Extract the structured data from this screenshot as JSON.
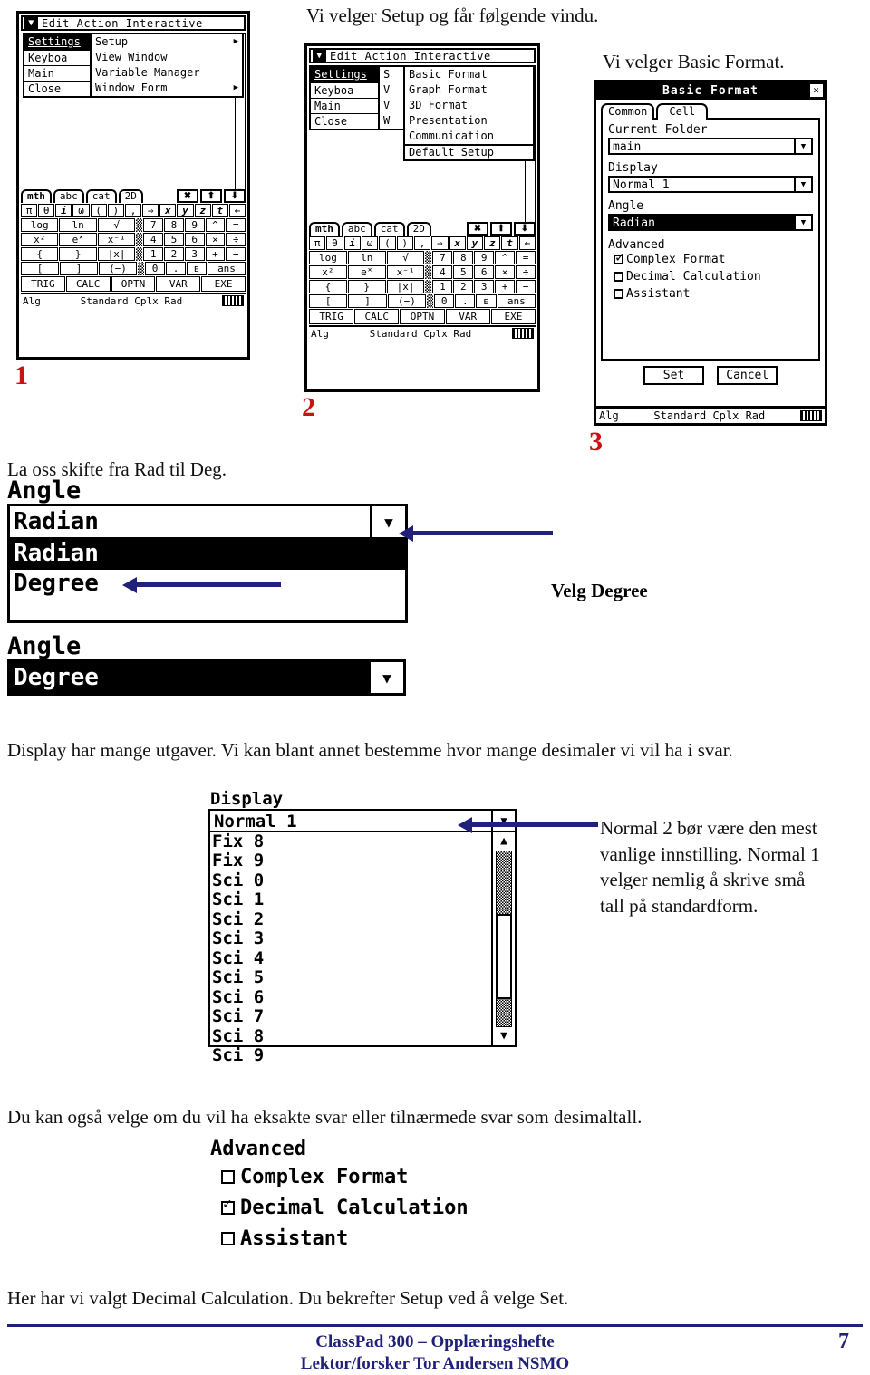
{
  "document": {
    "intro_text": "Vi velger Setup og får følgende vindu.",
    "basic_format_text": "Vi velger Basic Format.",
    "rad_to_deg_text": "La oss skifte fra Rad til Deg.",
    "velg_degree_text": "Velg Degree",
    "display_text": "Display har mange utgaver. Vi kan blant annet bestemme hvor mange desimaler vi vil ha i svar.",
    "normal_note": "Normal 2 bør være den mest vanlige innstilling. Normal 1 velger nemlig å skrive små tall på standardform.",
    "eksakt_text": "Du kan også velge om du vil ha eksakte svar eller tilnærmede svar som desimaltall.",
    "decimal_text": "Her har vi valgt Decimal Calculation. Du bekrefter Setup ved å velge Set."
  },
  "steps": {
    "one": "1",
    "two": "2",
    "three": "3"
  },
  "colors": {
    "step_red": "#cc1111",
    "arrow_blue": "#21217a"
  },
  "calculator": {
    "title_bar": "Edit Action Interactive",
    "logo_glyph": "▼",
    "settings_menu": [
      {
        "label": "Settings",
        "selected": true
      },
      {
        "label": "Keyboard",
        "selected": false
      },
      {
        "label": "Main",
        "selected": false
      },
      {
        "label": "Close",
        "selected": false
      }
    ],
    "settings_menu_clipped": [
      "Settings",
      "Keyboa",
      "Main",
      "Close"
    ],
    "setup_submenu": [
      {
        "label": "Setup",
        "arrow": "▶"
      },
      {
        "label": "View Window",
        "arrow": ""
      },
      {
        "label": "Variable Manager",
        "arrow": ""
      },
      {
        "label": "Window Form",
        "arrow": "▶"
      }
    ],
    "setup_submenu_clipped": [
      "S",
      "V",
      "V",
      "W"
    ],
    "setup_sub2": [
      {
        "label": "Basic Format"
      },
      {
        "label": "Graph Format"
      },
      {
        "label": "3D Format"
      },
      {
        "label": "Presentation"
      },
      {
        "label": "Communication"
      },
      {
        "label": "Default Setup"
      }
    ],
    "keyboard": {
      "tabs": [
        "mth",
        "abc",
        "cat",
        "2D"
      ],
      "tab_icons": [
        "✖",
        "⬆",
        "⬇"
      ],
      "row_symbols": [
        "π",
        "θ",
        "i",
        "ω",
        "(",
        ")",
        ",",
        "⇒",
        "x",
        "y",
        "z",
        "t",
        "←"
      ],
      "rows": [
        {
          "left": [
            "log",
            "ln",
            "√"
          ],
          "right": [
            "7",
            "8",
            "9"
          ],
          "ops": [
            "^",
            "="
          ]
        },
        {
          "left": [
            "x²",
            "e˟",
            "x⁻¹"
          ],
          "right": [
            "4",
            "5",
            "6"
          ],
          "ops": [
            "×",
            "÷"
          ]
        },
        {
          "left": [
            "{",
            "}",
            "|x|"
          ],
          "right": [
            "1",
            "2",
            "3"
          ],
          "ops": [
            "+",
            "−"
          ]
        },
        {
          "left": [
            "[",
            "]",
            "(−)"
          ],
          "right": [
            "0",
            ".",
            "ᴇ"
          ],
          "ops": [
            "ans"
          ]
        }
      ],
      "function_keys": [
        "TRIG",
        "CALC",
        "OPTN",
        "VAR",
        "EXE"
      ]
    },
    "status_bar": {
      "left": "Alg",
      "middle": "Standard Cplx Rad",
      "battery": "battery-icon"
    }
  },
  "basic_format_dialog": {
    "title": "Basic Format",
    "close_glyph": "✕",
    "tabs": [
      {
        "label": "Common",
        "active": true
      },
      {
        "label": "Cell",
        "active": false
      }
    ],
    "fields": [
      {
        "label": "Current Folder",
        "value": "main",
        "highlighted": false
      },
      {
        "label": "Display",
        "value": "Normal 1",
        "highlighted": false
      },
      {
        "label": "Angle",
        "value": "Radian",
        "highlighted": true
      }
    ],
    "advanced_label": "Advanced",
    "advanced_items": [
      {
        "label": "Complex Format",
        "checked": true
      },
      {
        "label": "Decimal Calculation",
        "checked": false
      },
      {
        "label": "Assistant",
        "checked": false
      }
    ],
    "buttons": [
      {
        "label": "Set"
      },
      {
        "label": "Cancel"
      }
    ],
    "status_bar": {
      "left": "Alg",
      "middle": "Standard Cplx Rad"
    }
  },
  "angle_dropdown_open": {
    "label": "Angle",
    "value": "Radian",
    "dropdown_glyph": "▼",
    "options": [
      {
        "label": "Radian",
        "selected": true
      },
      {
        "label": "Degree",
        "selected": false
      }
    ]
  },
  "angle_dropdown_closed": {
    "label": "Angle",
    "value": "Degree",
    "dropdown_glyph": "▼"
  },
  "display_dropdown": {
    "label": "Display",
    "value": "Normal 1",
    "dropdown_glyph": "▼",
    "up_glyph": "▲",
    "down_glyph": "▼",
    "options": [
      "Fix 8",
      "Fix 9",
      "Sci 0",
      "Sci 1",
      "Sci 2",
      "Sci 3",
      "Sci 4",
      "Sci 5",
      "Sci 6",
      "Sci 7",
      "Sci 8",
      "Sci 9"
    ]
  },
  "advanced_block": {
    "title": "Advanced",
    "items": [
      {
        "label": "Complex Format",
        "checked": false
      },
      {
        "label": "Decimal Calculation",
        "checked": true
      },
      {
        "label": "Assistant",
        "checked": false
      }
    ]
  },
  "footer": {
    "line1": "ClassPad 300 – Opplæringshefte",
    "line2": "Lektor/forsker Tor Andersen NSMO",
    "page": "7"
  }
}
